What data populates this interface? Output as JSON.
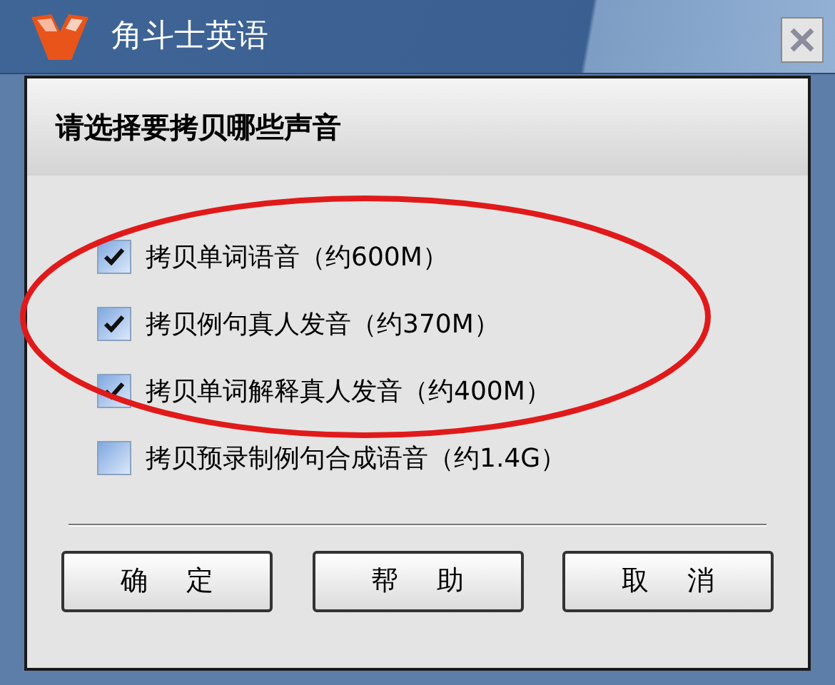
{
  "window": {
    "title": "角斗士英语"
  },
  "heading": "请选择要拷贝哪些声音",
  "options": [
    {
      "label": "拷贝单词语音（约600M）",
      "checked": true
    },
    {
      "label": "拷贝例句真人发音（约370M）",
      "checked": true
    },
    {
      "label": "拷贝单词解释真人发音（约400M）",
      "checked": true
    },
    {
      "label": "拷贝预录制例句合成语音（约1.4G）",
      "checked": false
    }
  ],
  "buttons": [
    "确定",
    "帮助",
    "取消"
  ]
}
